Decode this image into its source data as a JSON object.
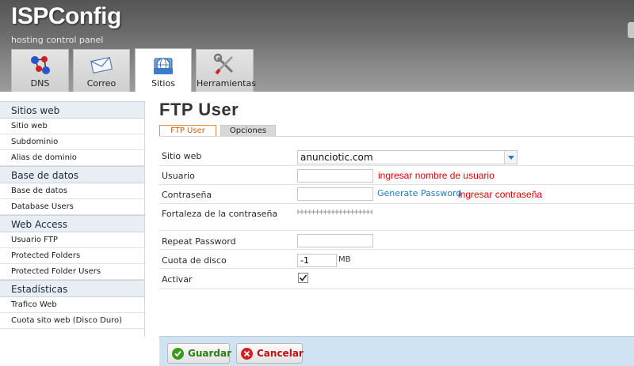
{
  "header": {
    "logo": "ISPConfig",
    "tagline": "hosting control panel",
    "tabs": [
      {
        "label": "DNS",
        "icon": "dns-icon",
        "active": false
      },
      {
        "label": "Correo",
        "icon": "mail-envelope-icon",
        "active": false
      },
      {
        "label": "Sitios",
        "icon": "globe-folder-icon",
        "active": true
      },
      {
        "label": "Herramientas",
        "icon": "tools-icon",
        "active": false
      }
    ]
  },
  "sidebar": {
    "sections": [
      {
        "title": "Sitios web",
        "items": [
          "Sitio web",
          "Subdominio",
          "Alias de dominio"
        ]
      },
      {
        "title": "Base de datos",
        "items": [
          "Base de datos",
          "Database Users"
        ]
      },
      {
        "title": "Web Access",
        "items": [
          "Usuario FTP",
          "Protected Folders",
          "Protected Folder Users"
        ]
      },
      {
        "title": "Estadísticas",
        "items": [
          "Trafico Web",
          "Cuota sito web (Disco Duro)"
        ]
      }
    ]
  },
  "main": {
    "title": "FTP User",
    "subtabs": [
      {
        "label": "FTP User",
        "active": true
      },
      {
        "label": "Opciones",
        "active": false
      }
    ],
    "form": {
      "sitio_web": {
        "label": "Sitio web",
        "value": "anunciotic.com"
      },
      "usuario": {
        "label": "Usuario",
        "value": "",
        "annotation": "ingresar nombre de usuario"
      },
      "contrasena": {
        "label": "Contraseña",
        "value": "",
        "generate_link": "Generate Password",
        "annotation": "ingresar  contraseña"
      },
      "fortaleza": {
        "label": "Fortaleza de la contraseña",
        "level": 0
      },
      "repeat": {
        "label": "Repeat Password",
        "value": ""
      },
      "cuota": {
        "label": "Cuota de disco",
        "value": "-1",
        "unit": "MB"
      },
      "activar": {
        "label": "Activar",
        "checked": true
      }
    }
  },
  "footer": {
    "save_label": "Guardar",
    "cancel_label": "Cancelar"
  },
  "colors": {
    "accent_orange": "#d06010",
    "link_blue": "#2a7ab5",
    "annotation_red": "#e00000",
    "footer_bg": "#cfe3f2",
    "save_green": "#2e7d14",
    "cancel_red": "#c01010"
  }
}
